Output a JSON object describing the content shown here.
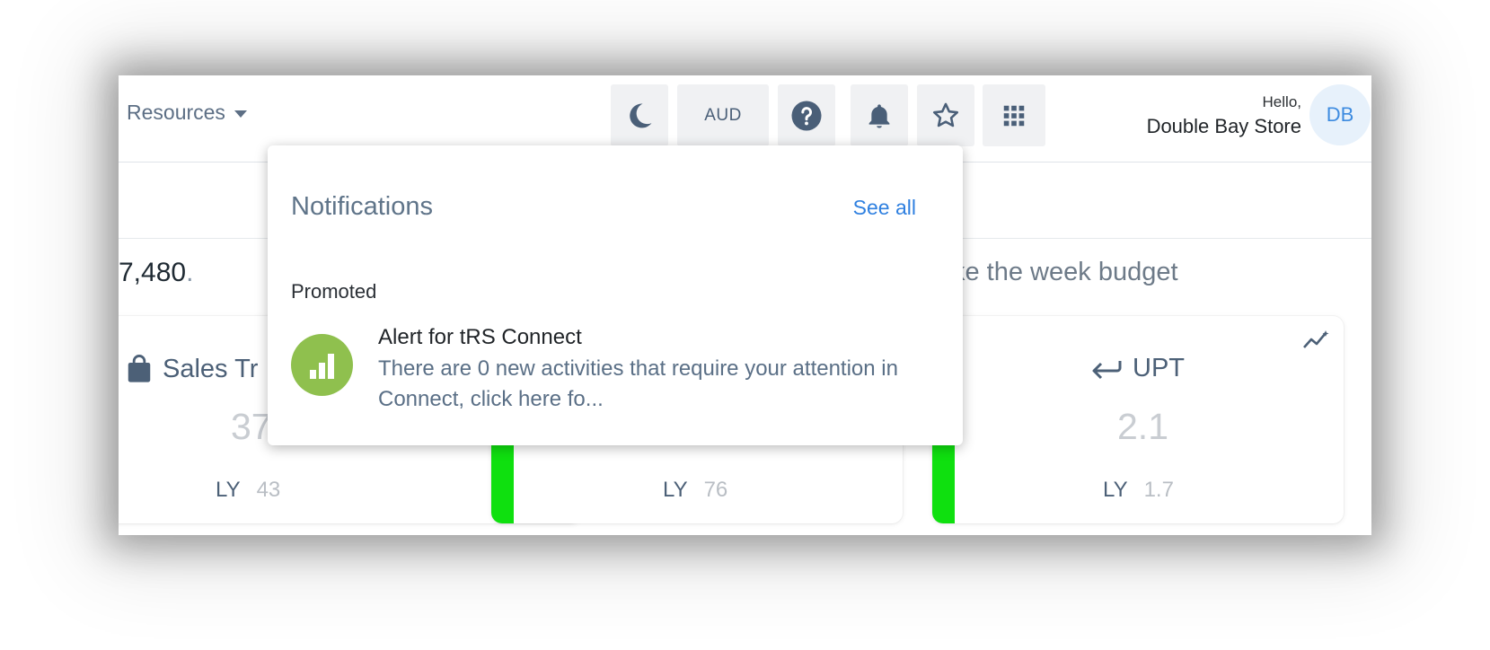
{
  "header": {
    "resources_label": "Resources",
    "currency_label": "AUD",
    "greeting": "Hello,",
    "store_name": "Double Bay Store",
    "avatar_initials": "DB"
  },
  "summary": {
    "left_text": "7,480",
    "left_suffix": ".",
    "right_text": "ke the week budget"
  },
  "cards": [
    {
      "title": "Sales Tr",
      "value": "37",
      "ly_label": "LY",
      "ly_value": "43"
    },
    {
      "title": "",
      "value": "",
      "ly_label": "LY",
      "ly_value": "76"
    },
    {
      "title": "UPT",
      "value": "2.1",
      "ly_label": "LY",
      "ly_value": "1.7"
    }
  ],
  "notifications": {
    "title": "Notifications",
    "see_all": "See all",
    "section": "Promoted",
    "items": [
      {
        "title": "Alert for tRS Connect",
        "body": "There are 0 new activities that require your attention in Connect, click here fo..."
      }
    ]
  },
  "colors": {
    "accent": "#2f80e0",
    "status_green": "#0fe00f",
    "notification_icon_bg": "#8fc04e"
  }
}
